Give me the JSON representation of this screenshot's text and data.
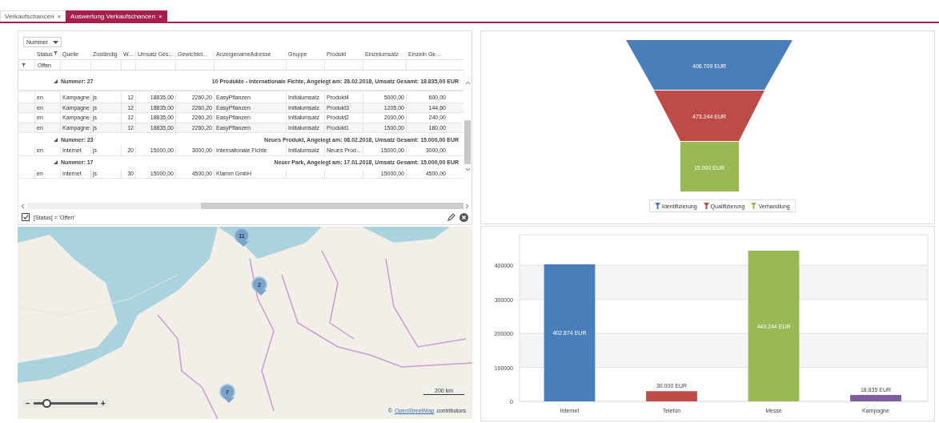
{
  "tabs": [
    {
      "label": "Verkaufschancen",
      "close": "×",
      "selected": false
    },
    {
      "label": "Auswertung Verkaufschancen",
      "close": "×",
      "selected": true
    }
  ],
  "grid": {
    "group_by": "Nummer",
    "columns": [
      "Status",
      "Quelle",
      "Zuständig",
      "W...",
      "Umsatz Ges...",
      "Gewichtet...",
      "AnzeigenameAdresse",
      "Gruppe",
      "Produkt",
      "Einzelumsatz",
      "Einzeln Ge..."
    ],
    "filter_value": "Offen",
    "groups": [
      {
        "label": "Nummer: 27",
        "summary": "10 Produkte - Internationale Fichte,  Angelegt am: 28.02.2018,  Umsatz Gesamt: 18.835,00 EUR",
        "expanded": true,
        "rows": [
          [
            "en",
            "Kampagne",
            "js",
            "12",
            "18835,00",
            "2260,20",
            "EasyPflanzen",
            "Initialumsatz",
            "Produkt4",
            "5000,00",
            "600,00"
          ],
          [
            "en",
            "Kampagne",
            "js",
            "12",
            "18835,00",
            "2260,20",
            "EasyPflanzen",
            "Initialumsatz",
            "Produkt3",
            "1205,00",
            "144,60"
          ],
          [
            "en",
            "Kampagne",
            "js",
            "12",
            "18835,00",
            "2260,20",
            "EasyPflanzen",
            "Initialumsatz",
            "Produkt2",
            "2000,00",
            "240,00"
          ],
          [
            "en",
            "Kampagne",
            "js",
            "12",
            "18835,00",
            "2260,20",
            "EasyPflanzen",
            "Initialumsatz",
            "Produkt1",
            "1500,00",
            "180,00"
          ]
        ]
      },
      {
        "label": "Nummer: 23",
        "summary": "Neues Produkt,  Angelegt am: 08.02.2018,  Umsatz Gesamt: 15.000,00 EUR",
        "expanded": true,
        "rows": [
          [
            "en",
            "Internet",
            "js",
            "20",
            "15000,00",
            "3000,00",
            "Internationale Fichte",
            "Initialumsatz",
            "Neues Prod...",
            "15000,00",
            "3000,00"
          ]
        ]
      },
      {
        "label": "Nummer: 17",
        "summary": "Neuer Park,  Angelegt am: 17.01.2018,  Umsatz Gesamt: 15.000,00 EUR",
        "expanded": true,
        "rows": [
          [
            "en",
            "Internet",
            "js",
            "30",
            "15000,00",
            "4500,00",
            "Klamm GmbH",
            "",
            "",
            "15000,00",
            "4500,00"
          ]
        ]
      }
    ],
    "filter_bar": {
      "checked": true,
      "expression": "[Status] = 'Offen'"
    }
  },
  "map": {
    "markers": [
      {
        "count": "11"
      },
      {
        "count": "2"
      },
      {
        "count": "7"
      }
    ],
    "zoom_out": "−",
    "zoom_in": "+",
    "zoom": {
      "level": 0.2
    },
    "scale": "200 km",
    "attribution": {
      "prefix": "©",
      "link": "OpenStreetMap",
      "suffix": "contributors"
    }
  },
  "funnel": {
    "segments": [
      {
        "label": "406.709 EUR",
        "legend": "Identifizierung",
        "color": "#4a7ebb"
      },
      {
        "label": "473.244 EUR",
        "legend": "Qualifizierung",
        "color": "#be4b48"
      },
      {
        "label": "15.000 EUR",
        "legend": "Verhandlung",
        "color": "#98b954"
      }
    ]
  },
  "bar_chart": {
    "chart_data": {
      "type": "bar",
      "categories": [
        "Internet",
        "Telefon",
        "Messe",
        "Kampagne"
      ],
      "values": [
        402874,
        30000,
        443244,
        18835
      ],
      "colors": [
        "#4a7ebb",
        "#be4b48",
        "#98b954",
        "#7d5fa0"
      ],
      "value_labels": [
        "402.874 EUR",
        "30.000 EUR",
        "443.244 EUR",
        "18.835 EUR"
      ],
      "ylim": [
        0,
        490000
      ],
      "grid": true,
      "yticks": [
        0,
        100000,
        200000,
        300000,
        400000
      ]
    }
  }
}
